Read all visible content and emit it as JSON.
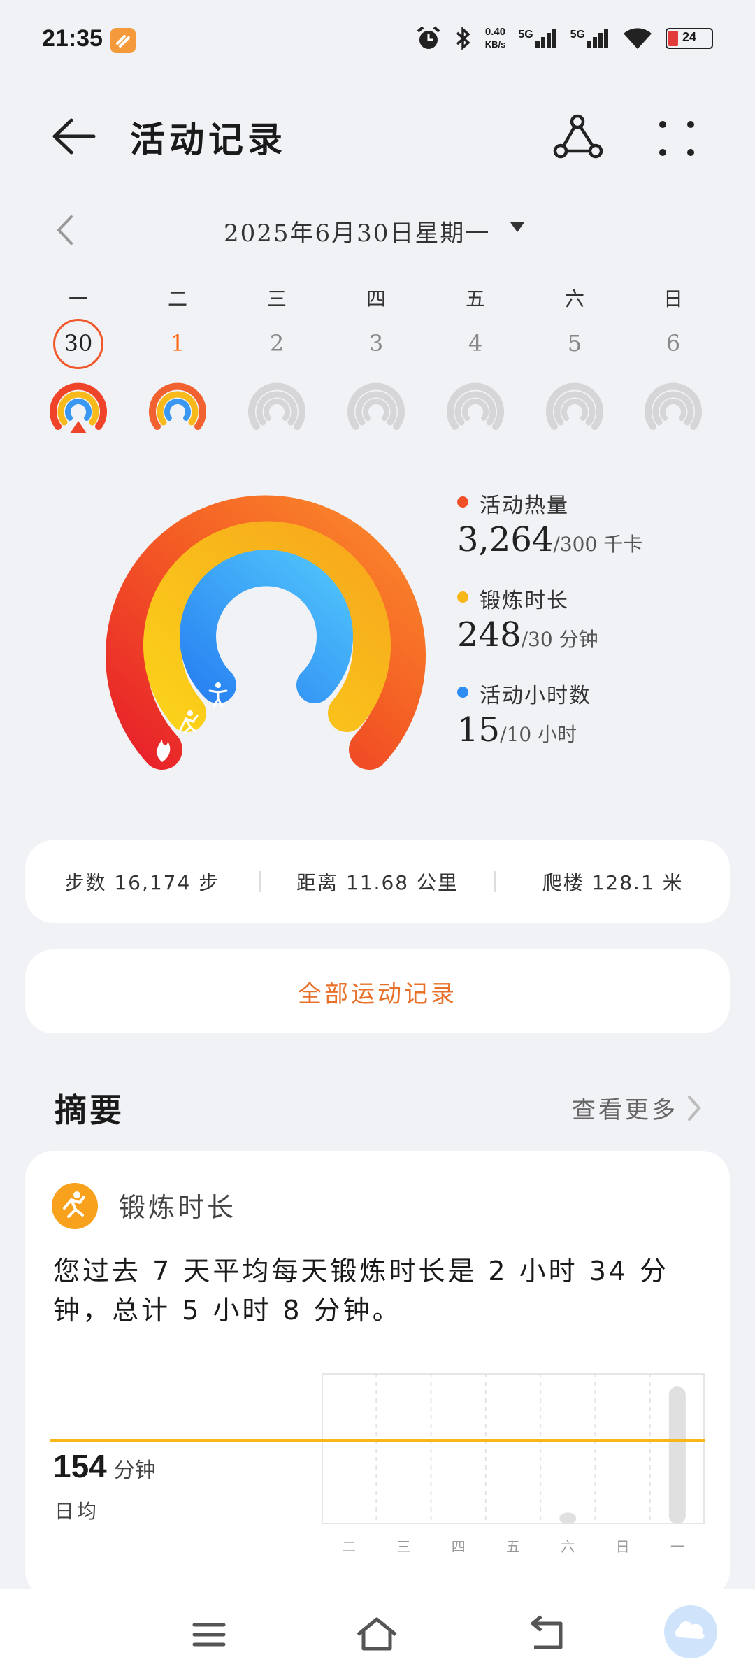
{
  "status": {
    "time": "21:35",
    "speed_value": "0.40",
    "speed_unit": "KB/s",
    "sim1": "5G",
    "sim2": "5G",
    "battery": "24"
  },
  "header": {
    "title": "活动记录"
  },
  "date": {
    "label": "2025年6月30日星期一"
  },
  "week": {
    "weekdays": [
      "一",
      "二",
      "三",
      "四",
      "五",
      "六",
      "日"
    ],
    "days": [
      "30",
      "1",
      "2",
      "3",
      "4",
      "5",
      "6"
    ]
  },
  "legend": {
    "calories": {
      "label": "活动热量",
      "value": "3,264",
      "goal": "/300 千卡",
      "color": "#f05028"
    },
    "exercise": {
      "label": "锻炼时长",
      "value": "248",
      "goal": "/30 分钟",
      "color": "#f7b719"
    },
    "hours": {
      "label": "活动小时数",
      "value": "15",
      "goal": "/10 小时",
      "color": "#2f8cf0"
    }
  },
  "stats": {
    "steps": "步数 16,174 步",
    "distance": "距离 11.68 公里",
    "floors": "爬楼 128.1 米"
  },
  "all_records": "全部运动记录",
  "summary": {
    "title": "摘要",
    "see_more": "查看更多",
    "card_title": "锻炼时长",
    "description": "您过去 7 天平均每天锻炼时长是 2 小时 34 分钟，总计 5 小时 8 分钟。",
    "avg_value": "154",
    "avg_unit": "分钟",
    "avg_label": "日均"
  },
  "chart_data": {
    "type": "bar",
    "categories": [
      "二",
      "三",
      "四",
      "五",
      "六",
      "日",
      "一"
    ],
    "values": [
      0,
      0,
      0,
      0,
      24,
      0,
      284
    ],
    "average": 154,
    "ylim": [
      0,
      300
    ],
    "colors": {
      "bar": "#e0e0e0",
      "average": "#f7b719"
    }
  }
}
